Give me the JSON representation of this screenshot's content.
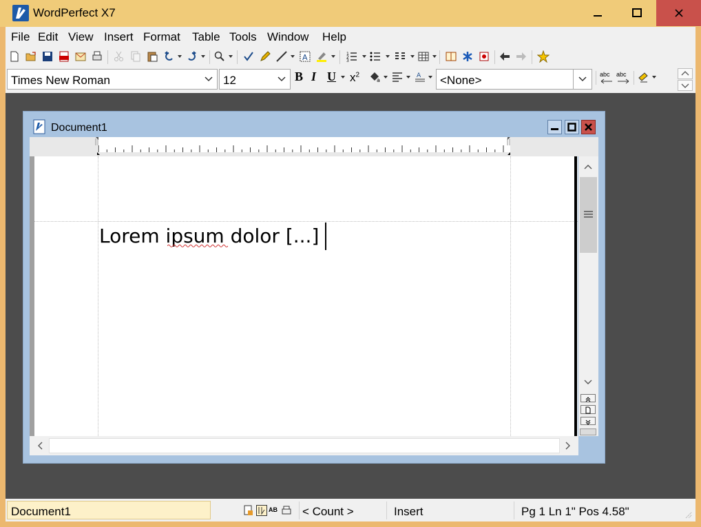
{
  "app": {
    "title": "WordPerfect X7",
    "window_buttons": [
      "minimize-icon",
      "maximize-icon",
      "close-icon"
    ],
    "accent_titlebar": "#f0cb79",
    "accent_close": "#c9514b"
  },
  "menu": [
    "File",
    "Edit",
    "View",
    "Insert",
    "Format",
    "Table",
    "Tools",
    "Window",
    "Help"
  ],
  "toolbar": {
    "icons": [
      "new-document-icon",
      "open-icon",
      "save-icon",
      "pdf-icon",
      "mail-icon",
      "print-icon",
      "cut-icon",
      "copy-icon",
      "paste-icon",
      "undo-icon",
      "redo-icon",
      "zoom-icon",
      "spellcheck-icon",
      "highlight-pen-icon",
      "line-icon",
      "text-box-icon",
      "highlight-icon",
      "numbering-icon",
      "bullets-icon",
      "columns-icon",
      "table-icon",
      "reference-icon",
      "symbol-icon",
      "clipart-icon",
      "back-icon",
      "forward-icon",
      "favorite-icon"
    ]
  },
  "propbar": {
    "font_name": "Times New Roman",
    "font_size": "12",
    "bold": "B",
    "italic": "I",
    "underline": "U",
    "superscript": "x",
    "superscript_exp": "2",
    "style": "<None>",
    "abc1": "abc",
    "abc2": "abc"
  },
  "document": {
    "title": "Document1",
    "text": "Lorem ipsum dolor [...]"
  },
  "status": {
    "doc_name": "Document1",
    "ab_label": "AB",
    "count": "< Count >",
    "mode": "Insert",
    "position": "Pg 1 Ln 1\" Pos 4.58\""
  }
}
